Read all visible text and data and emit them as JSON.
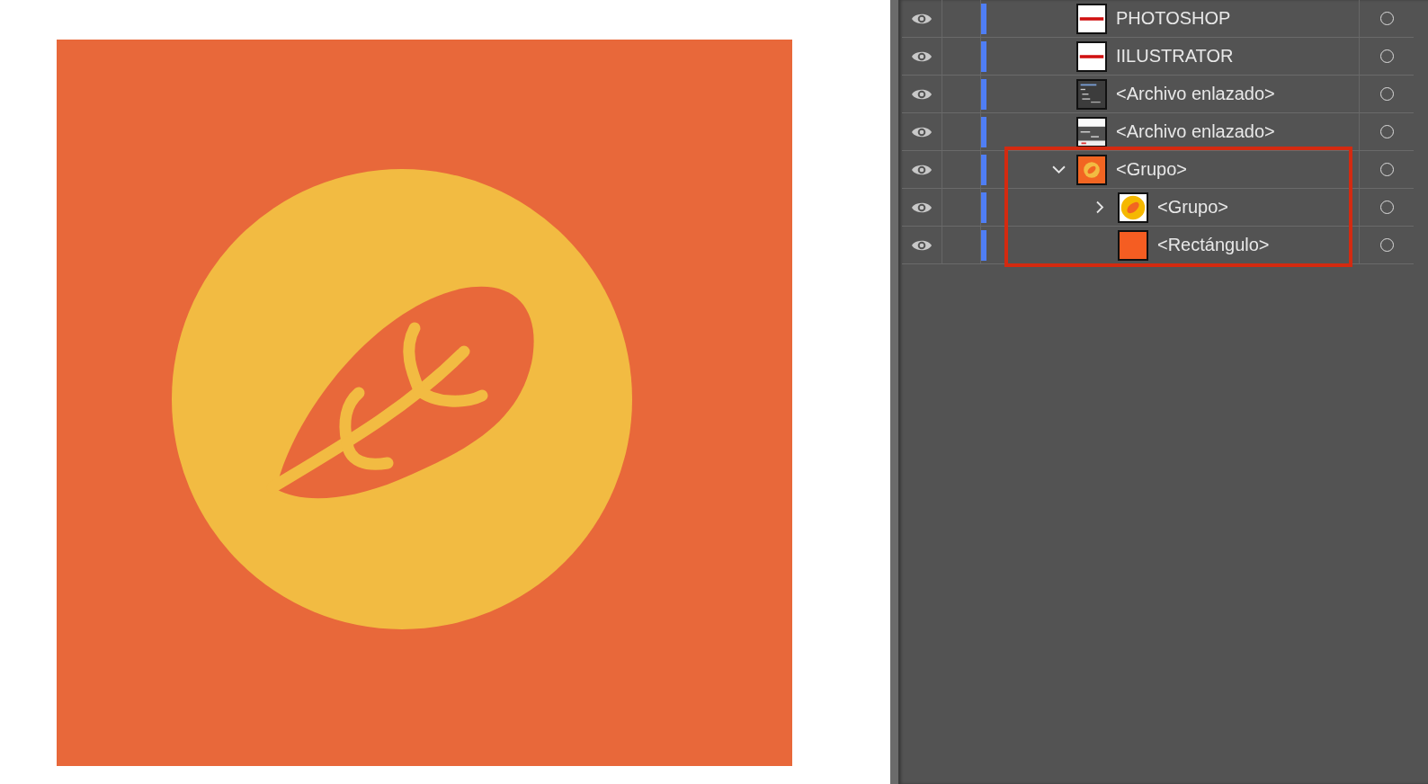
{
  "layers": [
    {
      "name": "PHOTOSHOP",
      "visible": true,
      "thumbnail": {
        "kind": "title-card"
      },
      "highlighted": false
    },
    {
      "name": "IILUSTRATOR",
      "visible": true,
      "thumbnail": {
        "kind": "title-card"
      },
      "highlighted": false
    },
    {
      "name": "<Archivo enlazado>",
      "visible": true,
      "thumbnail": {
        "kind": "dark-doc"
      },
      "highlighted": false
    },
    {
      "name": "<Archivo enlazado>",
      "visible": true,
      "thumbnail": {
        "kind": "light-doc"
      },
      "highlighted": false
    },
    {
      "name": "<Grupo>",
      "visible": true,
      "thumbnail": {
        "kind": "logo"
      },
      "highlighted": true,
      "expanded": true,
      "children": [
        {
          "name": "<Grupo>",
          "visible": true,
          "thumbnail": {
            "kind": "badge"
          },
          "highlighted": true,
          "expanded": false
        },
        {
          "name": "<Rectángulo>",
          "visible": true,
          "thumbnail": {
            "kind": "swatch"
          },
          "highlighted": true
        }
      ]
    }
  ]
}
